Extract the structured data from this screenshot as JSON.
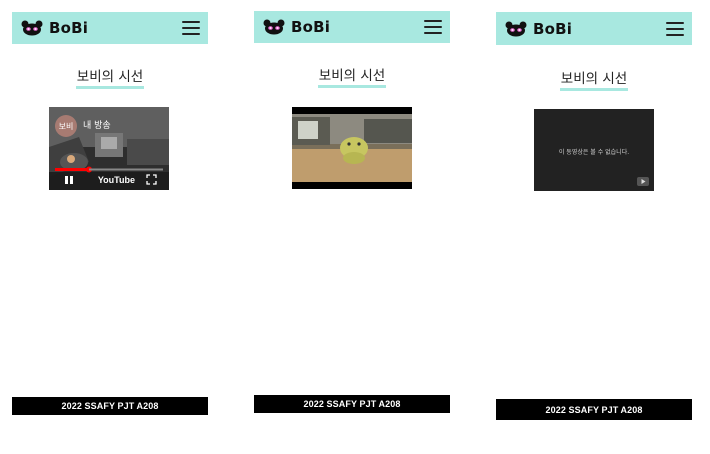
{
  "brand": {
    "name": "BoBi"
  },
  "page": {
    "title": "보비의 시선"
  },
  "live_player": {
    "channel_avatar": "보비",
    "video_title": "내 방송",
    "youtube_label": "YouTube"
  },
  "unavailable_player": {
    "message": "이 동영상은 볼 수 없습니다."
  },
  "footer": {
    "text": "2022 SSAFY PJT A208"
  },
  "colors": {
    "header_bg": "#a8e8e0",
    "footer_bg": "#000000",
    "logo_face": "#ee6fd8",
    "progress_red": "#ff0000"
  },
  "icons": [
    "panda-logo-icon",
    "hamburger-menu-icon",
    "pause-icon",
    "fullscreen-icon",
    "youtube-play-icon"
  ]
}
